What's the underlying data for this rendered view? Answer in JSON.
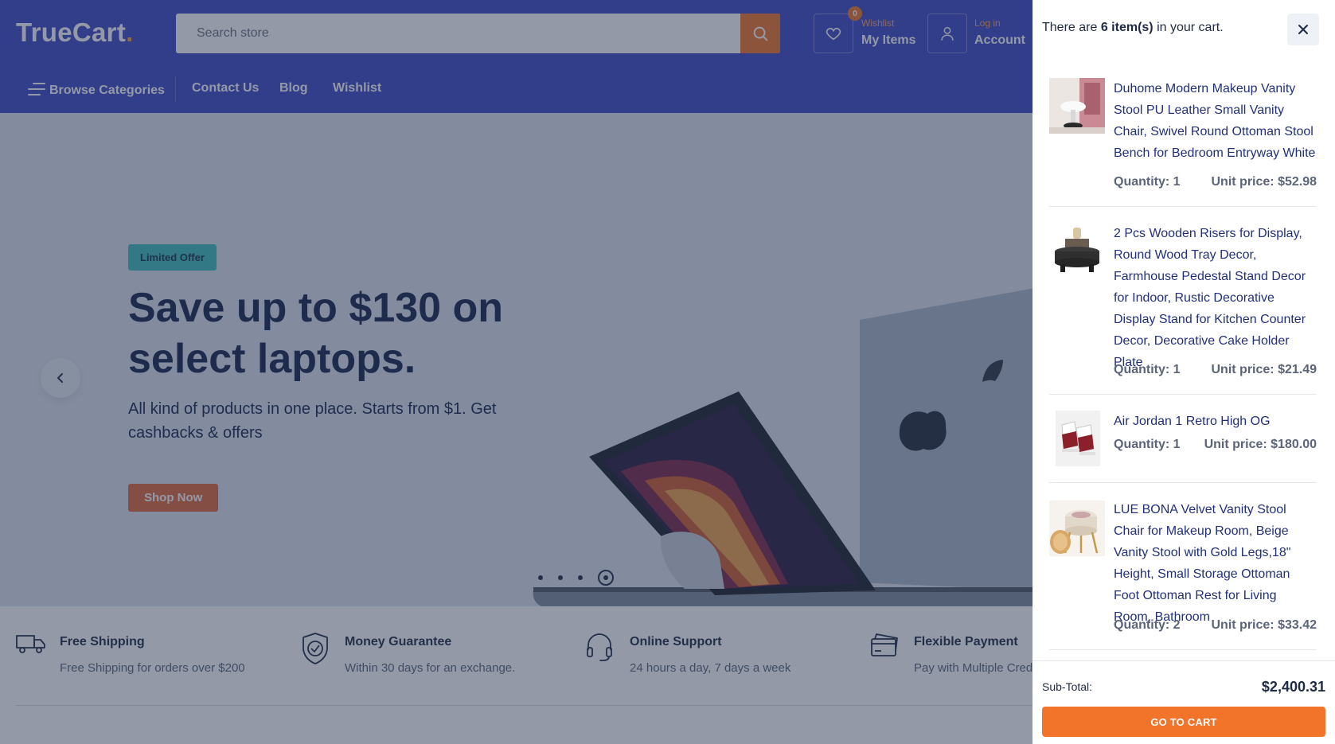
{
  "header": {
    "logo_text": "TrueCart",
    "logo_dot": ".",
    "search_placeholder": "Search store",
    "wishlist_badge": "0",
    "wishlist_small": "Wishlist",
    "wishlist_big": "My Items",
    "account_small": "Log in",
    "account_big": "Account"
  },
  "nav": {
    "browse": "Browse Categories",
    "items": [
      "Contact Us",
      "Blog",
      "Wishlist"
    ]
  },
  "hero": {
    "badge": "Limited Offer",
    "headline": "Save up to $130 on select laptops.",
    "subline": "All kind of products in one place. Starts from $1. Get cashbacks & offers",
    "cta": "Shop Now",
    "slide_count": 4,
    "active_slide": 4
  },
  "features": [
    {
      "icon": "truck-icon",
      "title": "Free Shipping",
      "subtitle": "Free Shipping for orders over $200"
    },
    {
      "icon": "shield-check-icon",
      "title": "Money Guarantee",
      "subtitle": "Within 30 days for an exchange."
    },
    {
      "icon": "headset-icon",
      "title": "Online Support",
      "subtitle": "24 hours a day, 7 days a week"
    },
    {
      "icon": "credit-card-icon",
      "title": "Flexible Payment",
      "subtitle": "Pay with Multiple Credit Cards"
    }
  ],
  "cart": {
    "heading_prefix": "There are",
    "heading_count": "6 item(s)",
    "heading_suffix": "in your cart.",
    "items": [
      {
        "name": "Duhome Modern Makeup Vanity Stool PU Leather Small Vanity Chair, Swivel Round Ottoman Stool Bench for Bedroom Entryway White",
        "quantity": "Quantity: 1",
        "unit_price": "Unit price: $52.98"
      },
      {
        "name": "2 Pcs Wooden Risers for Display, Round Wood Tray Decor, Farmhouse Pedestal Stand Decor for Indoor, Rustic Decorative Display Stand for Kitchen Counter Decor, Decorative Cake Holder Plate",
        "quantity": "Quantity: 1",
        "unit_price": "Unit price: $21.49"
      },
      {
        "name": "Air Jordan 1 Retro High OG",
        "quantity": "Quantity: 1",
        "unit_price": "Unit price: $180.00"
      },
      {
        "name": "LUE BONA Velvet Vanity Stool Chair for Makeup Room, Beige Vanity Stool with Gold Legs,18\" Height, Small Storage Ottoman Foot Ottoman Rest for Living Room, Bathroom",
        "quantity": "Quantity: 2",
        "unit_price": "Unit price: $33.42"
      }
    ],
    "subtotal_label": "Sub-Total:",
    "subtotal_value": "$2,400.31",
    "go_to_cart": "GO TO CART"
  },
  "colors": {
    "brand_blue": "#3d48c4",
    "accent_orange": "#f2742a",
    "offer_teal": "#3fbdbd"
  }
}
